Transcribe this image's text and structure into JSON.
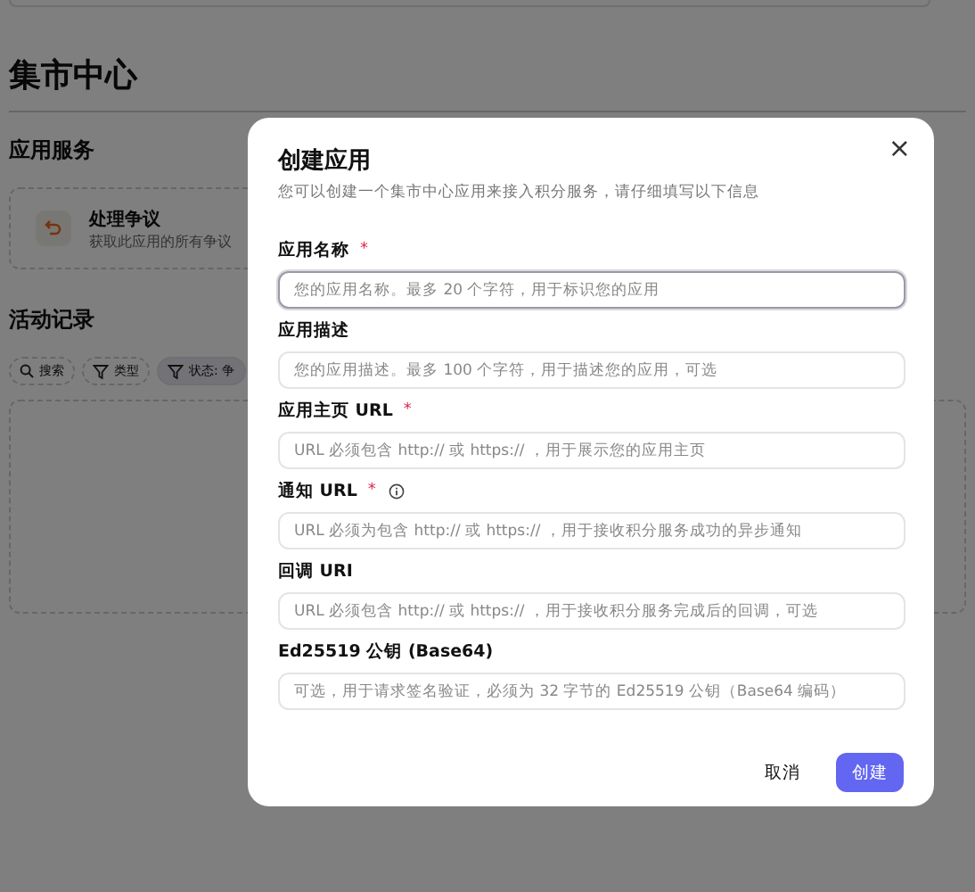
{
  "page": {
    "title": "集市中心",
    "services": {
      "heading": "应用服务",
      "items": [
        {
          "title": "处理争议",
          "subtitle": "获取此应用的所有争议"
        }
      ]
    },
    "activity": {
      "heading": "活动记录",
      "filters": [
        {
          "kind": "search",
          "label": "搜索",
          "active": false
        },
        {
          "kind": "filter",
          "label": "类型",
          "active": false
        },
        {
          "kind": "filter",
          "label": "状态: 争",
          "active": true
        }
      ]
    }
  },
  "dialog": {
    "title": "创建应用",
    "subtitle": "您可以创建一个集市中心应用来接入积分服务，请仔细填写以下信息",
    "fields": [
      {
        "label": "应用名称",
        "required": true,
        "info": false,
        "focused": true,
        "placeholder": "您的应用名称。最多 20 个字符，用于标识您的应用"
      },
      {
        "label": "应用描述",
        "required": false,
        "info": false,
        "focused": false,
        "placeholder": "您的应用描述。最多 100 个字符，用于描述您的应用，可选"
      },
      {
        "label": "应用主页 URL",
        "required": true,
        "info": false,
        "focused": false,
        "placeholder": "URL 必须包含 http:// 或 https:// ，用于展示您的应用主页"
      },
      {
        "label": "通知 URL",
        "required": true,
        "info": true,
        "focused": false,
        "placeholder": "URL 必须为包含 http:// 或 https:// ，用于接收积分服务成功的异步通知"
      },
      {
        "label": "回调 URI",
        "required": false,
        "info": false,
        "focused": false,
        "placeholder": "URL 必须包含 http:// 或 https:// ，用于接收积分服务完成后的回调，可选"
      },
      {
        "label": "Ed25519 公钥 (Base64)",
        "required": false,
        "info": false,
        "focused": false,
        "placeholder": "可选，用于请求签名验证，必须为 32 字节的 Ed25519 公钥（Base64 编码）"
      }
    ],
    "required_mark": "*",
    "close": "×",
    "cancel": "取消",
    "submit": "创建"
  }
}
